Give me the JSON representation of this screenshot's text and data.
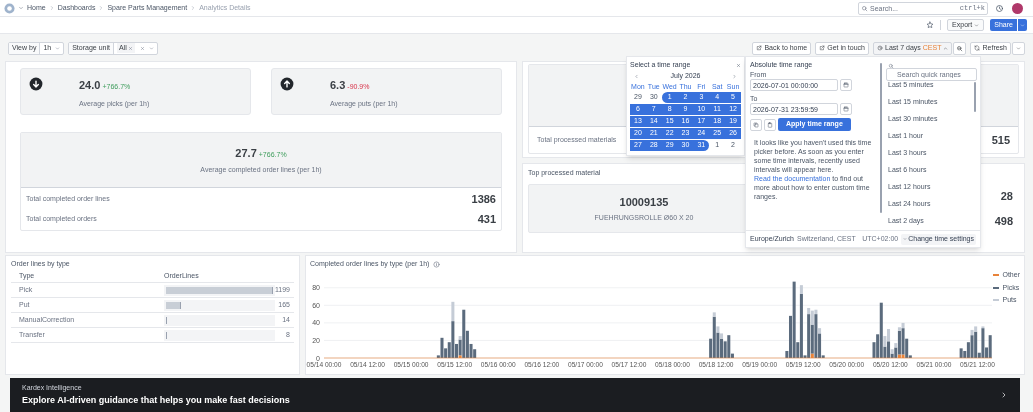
{
  "top_bar": {
    "breadcrumb": [
      "Home",
      "Dashboards",
      "Spare Parts Management",
      "Analytics Details"
    ],
    "search": {
      "placeholder": "Search...",
      "shortcut": "ctrl+k"
    }
  },
  "actions": {
    "export": "Export",
    "share": "Share"
  },
  "toolbar": {
    "filters": [
      {
        "label": "View by",
        "value": "1h",
        "clearable": false
      },
      {
        "label": "Storage unit",
        "value": "All",
        "clearable": true
      }
    ],
    "buttons": [
      "Back to home",
      "Get in touch"
    ],
    "time_range": {
      "label": "Last 7 days",
      "zone": "CEST"
    },
    "refresh": "Refresh"
  },
  "kpis": [
    {
      "value": "24.0",
      "change": "+766.7%",
      "label": "Average picks (per 1h)"
    },
    {
      "value": "6.3",
      "change": "-90.9%",
      "label": "Average puts (per 1h)"
    }
  ],
  "order_summary": {
    "value": "27.7",
    "change": "+766.7%",
    "label": "Average completed order lines (per 1h)",
    "rows": [
      {
        "label": "Total completed order lines",
        "value": "1386"
      },
      {
        "label": "Total completed orders",
        "value": "431"
      }
    ]
  },
  "materials_summary": {
    "rows": [
      {
        "label": "Total processed materials",
        "value": "515"
      }
    ]
  },
  "top_material": {
    "title": "Top processed material",
    "number": "10009135",
    "name": "FUEHRUNGSROLLE Ø60 X 20",
    "values": [
      "28",
      "498"
    ]
  },
  "calendar": {
    "title": "Select a time range",
    "month": "July 2026",
    "weekdays": [
      "Mon",
      "Tue",
      "Wed",
      "Thu",
      "Fri",
      "Sat",
      "Sun"
    ],
    "weeks": [
      [
        {
          "day": "29",
          "selected": false
        },
        {
          "day": "30",
          "selected": false
        },
        {
          "day": "1",
          "selected": true
        },
        {
          "day": "2",
          "selected": true
        },
        {
          "day": "3",
          "selected": true
        },
        {
          "day": "4",
          "selected": true
        },
        {
          "day": "5",
          "selected": true
        }
      ],
      [
        {
          "day": "6",
          "selected": true
        },
        {
          "day": "7",
          "selected": true
        },
        {
          "day": "8",
          "selected": true
        },
        {
          "day": "9",
          "selected": true
        },
        {
          "day": "10",
          "selected": true
        },
        {
          "day": "11",
          "selected": true
        },
        {
          "day": "12",
          "selected": true
        }
      ],
      [
        {
          "day": "13",
          "selected": true
        },
        {
          "day": "14",
          "selected": true
        },
        {
          "day": "15",
          "selected": true
        },
        {
          "day": "16",
          "selected": true
        },
        {
          "day": "17",
          "selected": true
        },
        {
          "day": "18",
          "selected": true
        },
        {
          "day": "19",
          "selected": true
        }
      ],
      [
        {
          "day": "20",
          "selected": true
        },
        {
          "day": "21",
          "selected": true
        },
        {
          "day": "22",
          "selected": true
        },
        {
          "day": "23",
          "selected": true
        },
        {
          "day": "24",
          "selected": true
        },
        {
          "day": "25",
          "selected": true
        },
        {
          "day": "26",
          "selected": true
        }
      ],
      [
        {
          "day": "27",
          "selected": true
        },
        {
          "day": "28",
          "selected": true
        },
        {
          "day": "29",
          "selected": true
        },
        {
          "day": "30",
          "selected": true
        },
        {
          "day": "31",
          "selected": true
        },
        {
          "day": "1",
          "selected": false
        },
        {
          "day": "2",
          "selected": false
        }
      ]
    ]
  },
  "time_picker": {
    "title": "Absolute time range",
    "from": {
      "label": "From",
      "value": "2026-07-01 00:00:00"
    },
    "to": {
      "label": "To",
      "value": "2026-07-31 23:59:59"
    },
    "apply": "Apply time range",
    "info": "It looks like you haven't used this time picker before. As soon as you enter some time intervals, recently used intervals will appear here.",
    "link": "Read the documentation",
    "info_after": " to find out more about how to enter custom time ranges.",
    "quick_search": {
      "placeholder": "Search quick ranges"
    },
    "quick_ranges": [
      "Last 5 minutes",
      "Last 15 minutes",
      "Last 30 minutes",
      "Last 1 hour",
      "Last 3 hours",
      "Last 6 hours",
      "Last 12 hours",
      "Last 24 hours",
      "Last 2 days"
    ],
    "timezone": "Europe/Zurich",
    "region": "Switzerland, CEST",
    "offset": "UTC+02:00",
    "settings": "Change time settings"
  },
  "order_lines": {
    "title": "Order lines by type",
    "columns": [
      "Type",
      "OrderLines"
    ],
    "rows": [
      {
        "type": "Pick",
        "count": "1199",
        "level": 1
      },
      {
        "type": "Put",
        "count": "165",
        "level": 0.14
      },
      {
        "type": "ManualCorrection",
        "count": "14",
        "level": 0.012
      },
      {
        "type": "Transfer",
        "count": "8",
        "level": 0.007
      }
    ]
  },
  "chart": {
    "title": "Completed order lines by type (per 1h)",
    "chart_data": {
      "type": "bar",
      "stacked": true,
      "grid": true,
      "ylim": [
        0,
        90
      ],
      "yticks": [
        0,
        20,
        40,
        60,
        80
      ],
      "categories": [
        "05/14 00:00",
        null,
        null,
        null,
        null,
        null,
        null,
        null,
        null,
        null,
        null,
        null,
        "05/14 12:00",
        null,
        null,
        null,
        null,
        null,
        null,
        null,
        null,
        null,
        null,
        null,
        "05/15 00:00",
        null,
        null,
        null,
        null,
        null,
        null,
        null,
        null,
        null,
        null,
        null,
        "05/15 12:00",
        null,
        null,
        null,
        null,
        null,
        null,
        null,
        null,
        null,
        null,
        null,
        "05/16 00:00",
        null,
        null,
        null,
        null,
        null,
        null,
        null,
        null,
        null,
        null,
        null,
        "05/16 12:00",
        null,
        null,
        null,
        null,
        null,
        null,
        null,
        null,
        null,
        null,
        null,
        "05/17 00:00",
        null,
        null,
        null,
        null,
        null,
        null,
        null,
        null,
        null,
        null,
        null,
        "05/17 12:00",
        null,
        null,
        null,
        null,
        null,
        null,
        null,
        null,
        null,
        null,
        null,
        "05/18 00:00",
        null,
        null,
        null,
        null,
        null,
        null,
        null,
        null,
        null,
        null,
        null,
        "05/18 12:00",
        null,
        null,
        null,
        null,
        null,
        null,
        null,
        null,
        null,
        null,
        null,
        "05/19 00:00",
        null,
        null,
        null,
        null,
        null,
        null,
        null,
        null,
        null,
        null,
        null,
        "05/19 12:00",
        null,
        null,
        null,
        null,
        null,
        null,
        null,
        null,
        null,
        null,
        null,
        "05/20 00:00",
        null,
        null,
        null,
        null,
        null,
        null,
        null,
        null,
        null,
        null,
        null,
        "05/20 12:00",
        null,
        null,
        null,
        null,
        null,
        null,
        null,
        null,
        null,
        null,
        null,
        "05/21 00:00",
        null,
        null,
        null,
        null,
        null,
        null,
        null,
        null,
        null,
        null,
        null,
        "05/21 12:00",
        null,
        null,
        null
      ],
      "series": [
        {
          "name": "Other",
          "color": "#e8833a",
          "values": [
            0,
            0,
            0,
            0,
            0,
            0,
            0,
            0,
            0,
            0,
            0,
            0,
            0,
            0,
            0,
            0,
            0,
            0,
            0,
            0,
            0,
            0,
            0,
            0,
            0,
            0,
            0,
            0,
            0,
            0,
            0,
            0,
            0,
            0,
            0,
            0,
            0,
            3,
            0,
            0,
            0,
            0,
            0,
            0,
            0,
            0,
            0,
            0,
            0,
            0,
            0,
            0,
            0,
            0,
            0,
            0,
            0,
            0,
            0,
            0,
            0,
            0,
            0,
            0,
            0,
            0,
            0,
            0,
            0,
            0,
            0,
            0,
            0,
            0,
            0,
            0,
            0,
            0,
            0,
            0,
            0,
            0,
            0,
            0,
            0,
            0,
            0,
            0,
            0,
            0,
            0,
            0,
            0,
            0,
            0,
            0,
            0,
            0,
            0,
            0,
            0,
            0,
            0,
            0,
            0,
            0,
            0,
            0,
            0,
            0,
            0,
            0,
            0,
            0,
            0,
            0,
            0,
            0,
            0,
            0,
            0,
            0,
            0,
            0,
            0,
            0,
            0,
            0,
            0,
            0,
            0,
            0,
            0,
            0,
            5,
            0,
            0,
            0,
            0,
            0,
            0,
            0,
            0,
            0,
            0,
            0,
            0,
            0,
            0,
            0,
            0,
            0,
            0,
            0,
            0,
            0,
            0,
            0,
            4,
            4,
            0,
            0,
            0,
            0,
            0,
            0,
            0,
            0,
            0,
            0,
            0,
            0,
            0,
            0,
            0,
            0,
            0,
            0,
            0,
            0,
            0,
            0,
            0,
            0
          ]
        },
        {
          "name": "Picks",
          "color": "#5b6b7d",
          "values": [
            0,
            0,
            0,
            0,
            0,
            0,
            0,
            0,
            0,
            0,
            0,
            0,
            0,
            0,
            0,
            0,
            0,
            0,
            0,
            0,
            0,
            0,
            0,
            0,
            0,
            0,
            0,
            0,
            0,
            0,
            0,
            3,
            23,
            11,
            18,
            42,
            16,
            18,
            55,
            31,
            16,
            10,
            0,
            0,
            0,
            0,
            0,
            0,
            0,
            0,
            0,
            0,
            0,
            0,
            0,
            0,
            0,
            0,
            0,
            0,
            0,
            0,
            0,
            0,
            0,
            0,
            0,
            0,
            0,
            0,
            0,
            0,
            0,
            0,
            0,
            0,
            0,
            0,
            0,
            0,
            0,
            0,
            0,
            0,
            0,
            0,
            0,
            0,
            0,
            0,
            0,
            0,
            0,
            0,
            0,
            0,
            0,
            0,
            0,
            0,
            0,
            0,
            0,
            0,
            0,
            0,
            22,
            47,
            29,
            22,
            19,
            26,
            5,
            0,
            0,
            0,
            0,
            0,
            0,
            0,
            0,
            0,
            0,
            0,
            0,
            0,
            0,
            8,
            48,
            87,
            18,
            73,
            3,
            50,
            33,
            50,
            28,
            3,
            0,
            0,
            0,
            0,
            0,
            0,
            0,
            0,
            0,
            0,
            0,
            0,
            0,
            18,
            27,
            63,
            13,
            19,
            5,
            12,
            27,
            30,
            22,
            3,
            0,
            0,
            0,
            0,
            0,
            0,
            0,
            0,
            0,
            0,
            0,
            0,
            0,
            11,
            8,
            18,
            26,
            30,
            6,
            34,
            12,
            26
          ]
        },
        {
          "name": "Puts",
          "color": "#c5ccd6",
          "values": [
            0,
            0,
            0,
            0,
            0,
            0,
            0,
            0,
            0,
            0,
            0,
            0,
            0,
            0,
            0,
            0,
            0,
            0,
            0,
            0,
            0,
            0,
            0,
            0,
            0,
            0,
            0,
            0,
            0,
            0,
            0,
            0,
            0,
            0,
            0,
            22,
            0,
            4,
            0,
            0,
            0,
            0,
            0,
            0,
            0,
            0,
            0,
            0,
            0,
            0,
            0,
            0,
            0,
            0,
            0,
            0,
            0,
            0,
            0,
            0,
            0,
            0,
            0,
            0,
            0,
            0,
            0,
            0,
            0,
            0,
            0,
            0,
            0,
            0,
            0,
            0,
            0,
            0,
            0,
            0,
            0,
            0,
            0,
            0,
            0,
            0,
            0,
            0,
            0,
            0,
            0,
            0,
            0,
            0,
            0,
            0,
            0,
            0,
            0,
            0,
            0,
            0,
            0,
            0,
            0,
            0,
            0,
            5,
            7,
            6,
            0,
            0,
            0,
            0,
            0,
            0,
            0,
            0,
            0,
            0,
            0,
            0,
            0,
            0,
            0,
            0,
            0,
            0,
            0,
            0,
            0,
            10,
            0,
            7,
            16,
            5,
            6,
            0,
            0,
            0,
            0,
            0,
            0,
            0,
            0,
            0,
            0,
            0,
            0,
            0,
            0,
            0,
            0,
            0,
            12,
            14,
            5,
            5,
            4,
            6,
            0,
            0,
            0,
            0,
            0,
            0,
            0,
            0,
            0,
            0,
            0,
            0,
            0,
            0,
            0,
            0,
            0,
            0,
            6,
            6,
            0,
            2,
            0,
            0
          ]
        }
      ]
    }
  },
  "banner": {
    "eyebrow": "Kardex Intelligence",
    "text": "Explore AI-driven guidance that helps you make fast decisions"
  }
}
